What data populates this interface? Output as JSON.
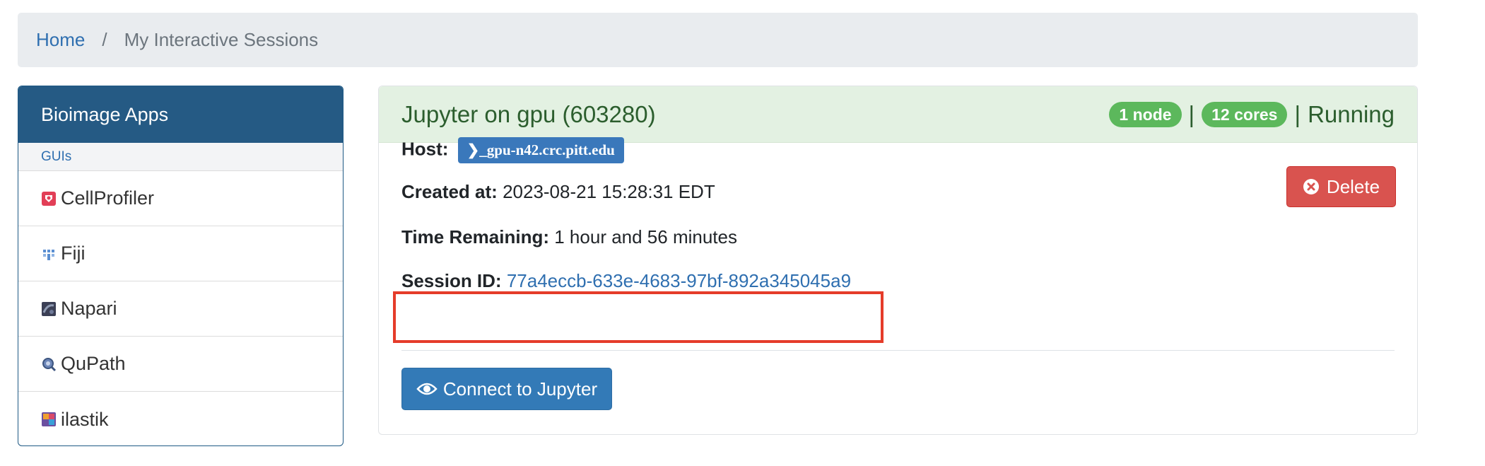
{
  "breadcrumb": {
    "home": "Home",
    "separator": "/",
    "current": "My Interactive Sessions"
  },
  "sidebar": {
    "title": "Bioimage Apps",
    "section": "GUIs",
    "items": [
      {
        "label": "CellProfiler",
        "icon": "cellprofiler-icon"
      },
      {
        "label": "Fiji",
        "icon": "fiji-icon"
      },
      {
        "label": "Napari",
        "icon": "napari-icon"
      },
      {
        "label": "QuPath",
        "icon": "qupath-icon"
      },
      {
        "label": "ilastik",
        "icon": "ilastik-icon"
      }
    ]
  },
  "session": {
    "title": "Jupyter on gpu (603280)",
    "nodes": "1 node",
    "cores": "12 cores",
    "status": "Running",
    "separator": "|",
    "host_label": "Host:",
    "host": "gpu-n42.crc.pitt.edu",
    "created_label": "Created at:",
    "created": "2023-08-21 15:28:31 EDT",
    "remaining_label": "Time Remaining:",
    "remaining": "1 hour and 56 minutes",
    "id_label": "Session ID:",
    "id": "77a4eccb-633e-4683-97bf-892a345045a9",
    "delete_label": "Delete",
    "connect_label": "Connect to Jupyter"
  },
  "colors": {
    "header_bg": "#e3f1e2",
    "sidebar_header": "#255a84",
    "delete": "#d9534f",
    "connect": "#337ab7",
    "highlight": "#e53c2a",
    "badge": "#5cb85c"
  }
}
